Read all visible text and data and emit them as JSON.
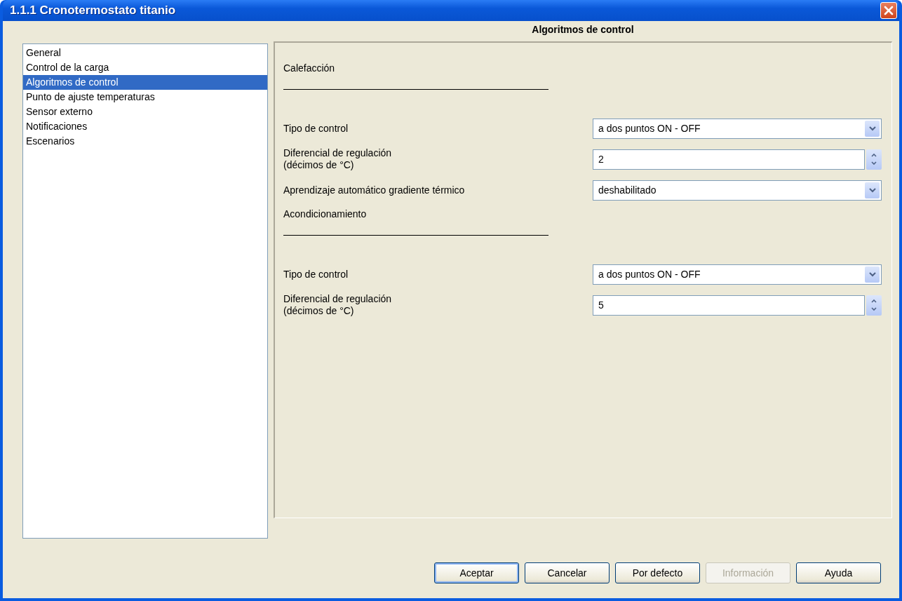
{
  "window": {
    "title": "1.1.1 Cronotermostato titanio"
  },
  "sidebar": {
    "items": [
      {
        "label": "General",
        "selected": false
      },
      {
        "label": "Control de la carga",
        "selected": false
      },
      {
        "label": "Algoritmos de control",
        "selected": true
      },
      {
        "label": "Punto de ajuste temperaturas",
        "selected": false
      },
      {
        "label": "Sensor externo",
        "selected": false
      },
      {
        "label": "Notificaciones",
        "selected": false
      },
      {
        "label": "Escenarios",
        "selected": false
      }
    ]
  },
  "panel": {
    "title": "Algoritmos de control",
    "rows": [
      {
        "kind": "heading",
        "label": "Calefacción"
      },
      {
        "kind": "select",
        "label": "Tipo de control",
        "value": "a dos puntos ON - OFF"
      },
      {
        "kind": "spin",
        "label": "Diferencial de regulación\n(décimos de °C)",
        "value": "2"
      },
      {
        "kind": "select",
        "label": "Aprendizaje automático gradiente térmico",
        "value": "deshabilitado"
      },
      {
        "kind": "heading",
        "label": "Acondicionamiento"
      },
      {
        "kind": "select",
        "label": "Tipo de control",
        "value": "a dos puntos ON - OFF"
      },
      {
        "kind": "spin",
        "label": "Diferencial de regulación\n(décimos de °C)",
        "value": "5"
      }
    ]
  },
  "buttons": [
    {
      "label": "Aceptar",
      "default": true,
      "disabled": false
    },
    {
      "label": "Cancelar",
      "default": false,
      "disabled": false
    },
    {
      "label": "Por defecto",
      "default": false,
      "disabled": false
    },
    {
      "label": "Información",
      "default": false,
      "disabled": true
    },
    {
      "label": "Ayuda",
      "default": false,
      "disabled": false
    }
  ]
}
